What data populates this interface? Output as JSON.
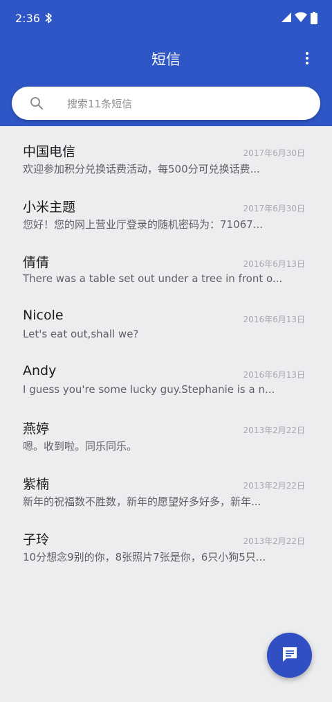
{
  "status_bar": {
    "time": "2:36"
  },
  "app_bar": {
    "title": "短信"
  },
  "search": {
    "placeholder": "搜索11条短信"
  },
  "conversations": [
    {
      "name": "中国电信",
      "date": "2017年6月30日",
      "preview": "欢迎参加积分兑换话费活动，每500分可兑换话费..."
    },
    {
      "name": "小米主题",
      "date": "2017年6月30日",
      "preview": "您好！您的网上营业厅登录的随机密码为：71067..."
    },
    {
      "name": "倩倩",
      "date": "2016年6月13日",
      "preview": "There was a table set out under a tree in front o..."
    },
    {
      "name": "Nicole",
      "date": "2016年6月13日",
      "preview": "Let's eat out,shall we?"
    },
    {
      "name": "Andy",
      "date": "2016年6月13日",
      "preview": "I guess you're some lucky guy.Stephanie is a n..."
    },
    {
      "name": "燕婷",
      "date": "2013年2月22日",
      "preview": "嗯。收到啦。同乐同乐。"
    },
    {
      "name": "紫楠",
      "date": "2013年2月22日",
      "preview": "新年的祝福数不胜数，新年的愿望好多好多，新年..."
    },
    {
      "name": "子玲",
      "date": "2013年2月22日",
      "preview": "10分想念9别的你，8张照片7张是你，6只小狗5只..."
    }
  ],
  "colors": {
    "primary": "#2f56c6",
    "background": "#ecedef",
    "fab": "#2f4fc2"
  },
  "icons": {
    "status": [
      "bluetooth-icon",
      "signal-icon",
      "wifi-icon",
      "battery-icon"
    ],
    "app_bar": [
      "more-vert-icon"
    ],
    "search": "search-icon",
    "fab": "compose-message-icon"
  }
}
